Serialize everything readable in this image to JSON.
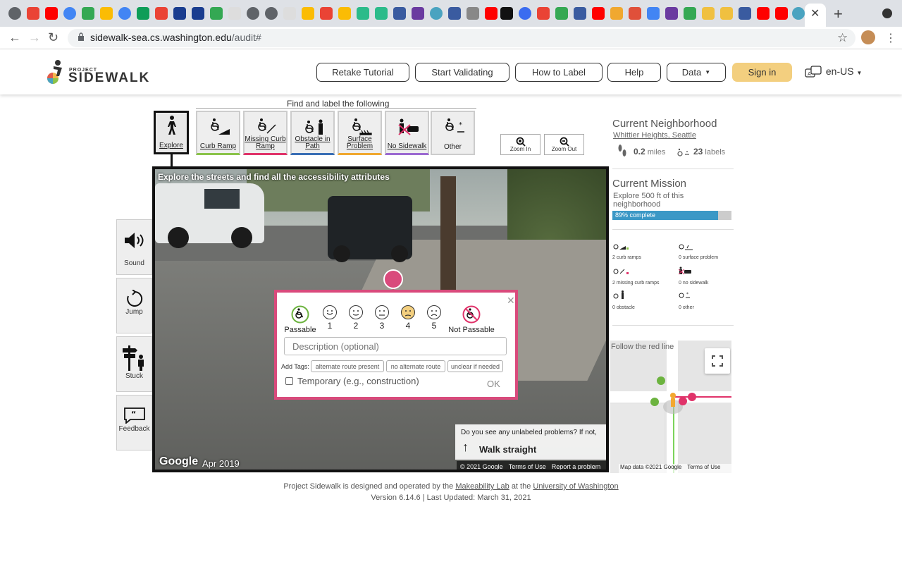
{
  "browser": {
    "url_host": "sidewalk-sea.cs.washington.edu",
    "url_path": "/audit#"
  },
  "header": {
    "logo_small": "PROJECT",
    "logo_big": "SIDEWALK",
    "nav": [
      "Retake Tutorial",
      "Start Validating",
      "How to Label",
      "Help",
      "Data"
    ],
    "signin": "Sign in",
    "language": "en-US"
  },
  "toolbar": {
    "title": "Find and label the following",
    "explore": "Explore",
    "tools": [
      {
        "label": "Curb Ramp",
        "color": "#8bc34a"
      },
      {
        "label": "Missing Curb Ramp",
        "color": "#e0336a"
      },
      {
        "label": "Obstacle in Path",
        "color": "#3a6fb5"
      },
      {
        "label": "Surface Problem",
        "color": "#f0a830"
      },
      {
        "label": "No Sidewalk",
        "color": "#9c6ad1"
      },
      {
        "label": "Other",
        "color": "#cccccc"
      }
    ],
    "zoom_in": "Zoom In",
    "zoom_out": "Zoom Out"
  },
  "side": {
    "sound": "Sound",
    "jump": "Jump",
    "stuck": "Stuck",
    "feedback": "Feedback"
  },
  "viewer": {
    "title": "Explore the streets and find all the accessibility attributes",
    "google": "Google",
    "date": "Apr 2019",
    "copyright": "© 2021 Google",
    "terms": "Terms of Use",
    "report": "Report a problem",
    "prompt": "Do you see any unlabeled problems? If not,",
    "walk": "Walk straight"
  },
  "popup": {
    "passable": "Passable",
    "not_passable": "Not Passable",
    "levels": [
      "1",
      "2",
      "3",
      "4",
      "5"
    ],
    "description_placeholder": "Description (optional)",
    "add_tags": "Add Tags:",
    "tags": [
      "alternate route present",
      "no alternate route",
      "unclear if needed"
    ],
    "temporary": "Temporary (e.g., construction)",
    "ok": "OK"
  },
  "neighborhood": {
    "heading": "Current Neighborhood",
    "name": "Whittier Heights, Seattle",
    "miles": "0.2",
    "miles_unit": "miles",
    "labels": "23",
    "labels_unit": "labels"
  },
  "mission": {
    "heading": "Current Mission",
    "description": "Explore 500 ft of this neighborhood",
    "progress_label": "89% complete",
    "progress": 0.89,
    "stats": [
      "2 curb ramps",
      "0 surface problem",
      "2 missing curb ramps",
      "0 no sidewalk",
      "0 obstacle",
      "0 other"
    ]
  },
  "minimap": {
    "label": "Follow the red line",
    "data": "Map data ©2021 Google",
    "terms": "Terms of Use"
  },
  "footer": {
    "pre": "Project Sidewalk is designed and operated by the",
    "lab": "Makeability Lab",
    "mid": "at the",
    "univ": "University of Washington",
    "version": "Version 6.14.6 | Last Updated: March 31, 2021"
  }
}
